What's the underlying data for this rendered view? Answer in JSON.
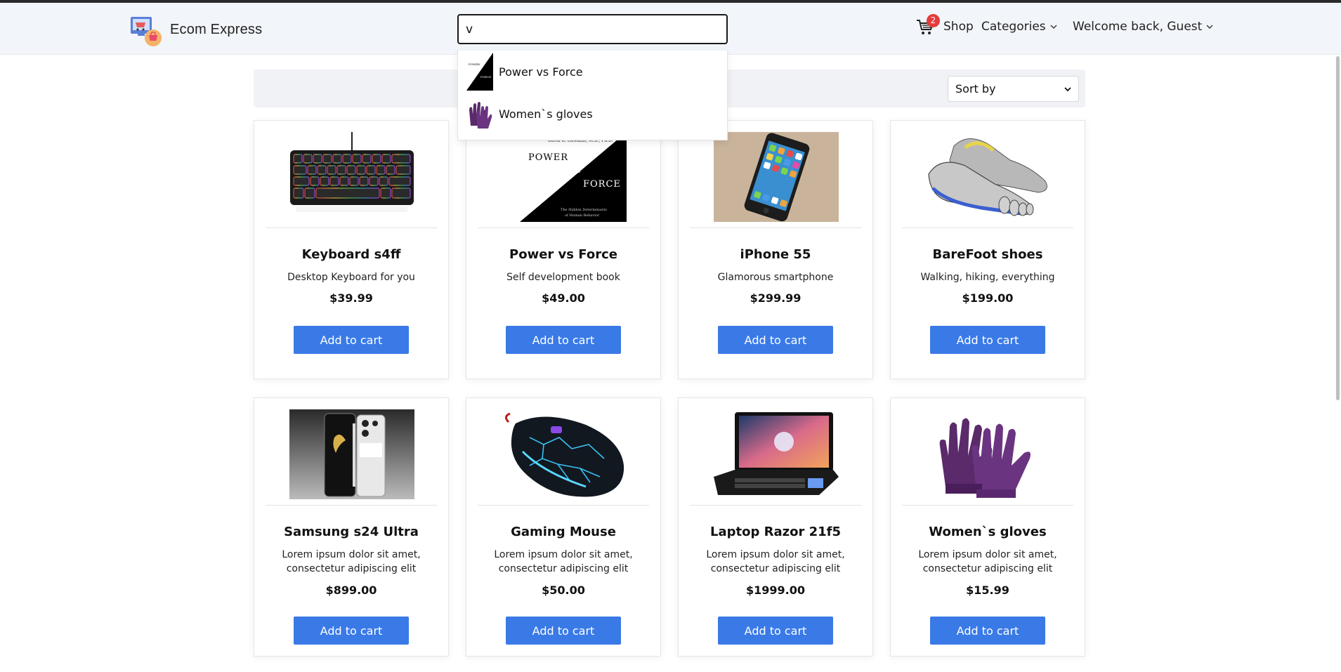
{
  "app": {
    "brand_name": "Ecom Express"
  },
  "search": {
    "value": "v",
    "suggestions": [
      {
        "label": "Power vs Force",
        "thumb": "book-cover"
      },
      {
        "label": "Women`s gloves",
        "thumb": "gloves"
      }
    ]
  },
  "nav": {
    "cart_count": "2",
    "shop_label": "Shop",
    "categories_label": "Categories",
    "welcome_label": "Welcome back, Guest"
  },
  "toolbar": {
    "sort_label": "Sort by"
  },
  "products": [
    {
      "name": "Keyboard s4ff",
      "desc": "Desktop Keyboard for you",
      "price": "$39.99",
      "button": "Add to cart",
      "image": "keyboard"
    },
    {
      "name": "Power vs Force",
      "desc": "Self development book",
      "price": "$49.00",
      "button": "Add to cart",
      "image": "book-cover"
    },
    {
      "name": "iPhone 55",
      "desc": "Glamorous smartphone",
      "price": "$299.99",
      "button": "Add to cart",
      "image": "phone"
    },
    {
      "name": "BareFoot shoes",
      "desc": "Walking, hiking, everything",
      "price": "$199.00",
      "button": "Add to cart",
      "image": "shoes"
    },
    {
      "name": "Samsung s24 Ultra",
      "desc": "Lorem ipsum dolor sit amet, consectetur adipiscing elit",
      "price": "$899.00",
      "button": "Add to cart",
      "image": "samsung-phone"
    },
    {
      "name": "Gaming Mouse",
      "desc": "Lorem ipsum dolor sit amet, consectetur adipiscing elit",
      "price": "$50.00",
      "button": "Add to cart",
      "image": "mouse"
    },
    {
      "name": "Laptop Razor 21f5",
      "desc": "Lorem ipsum dolor sit amet, consectetur adipiscing elit",
      "price": "$1999.00",
      "button": "Add to cart",
      "image": "laptop"
    },
    {
      "name": "Women`s gloves",
      "desc": "Lorem ipsum dolor sit amet, consectetur adipiscing elit",
      "price": "$15.99",
      "button": "Add to cart",
      "image": "gloves"
    }
  ],
  "colors": {
    "accent": "#3a7ae6",
    "badge": "#e63b3b",
    "navbar_bg": "#f2f5f9"
  }
}
